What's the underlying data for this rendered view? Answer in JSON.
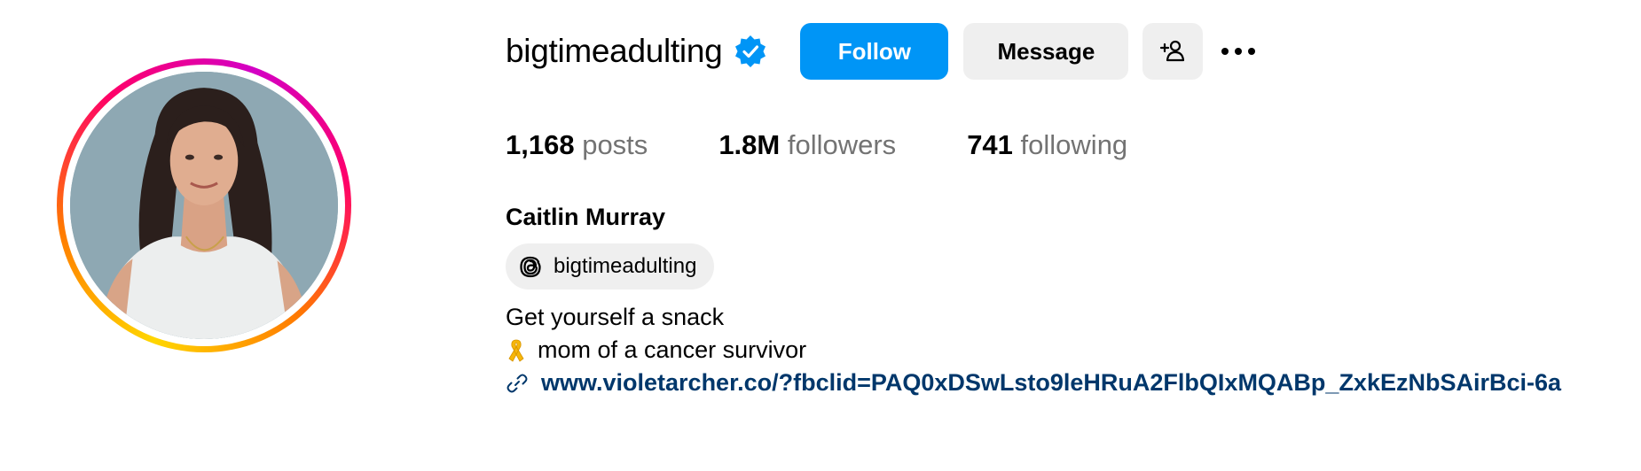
{
  "profile": {
    "username": "bigtimeadulting",
    "verified": true,
    "full_name": "Caitlin Murray",
    "threads_handle": "bigtimeadulting"
  },
  "actions": {
    "follow_label": "Follow",
    "message_label": "Message",
    "add_user_icon": "add-person-icon",
    "more_icon": "ellipsis-icon"
  },
  "stats": {
    "posts_count": "1,168",
    "posts_label": "posts",
    "followers_count": "1.8M",
    "followers_label": "followers",
    "following_count": "741",
    "following_label": "following"
  },
  "bio": {
    "line1": "Get yourself a snack",
    "line2": "mom of a cancer survivor",
    "line2_icon": "gold-ribbon-icon",
    "link": "www.violetarcher.co/?fbclid=PAQ0xDSwLsto9leHRuA2FlbQIxMQABp_ZxkEzNbSAirBci-6a"
  },
  "colors": {
    "follow_button": "#0095f6",
    "secondary_button": "#efefef",
    "verified_badge": "#0095f6",
    "link": "#00376b",
    "muted_text": "#737373"
  }
}
